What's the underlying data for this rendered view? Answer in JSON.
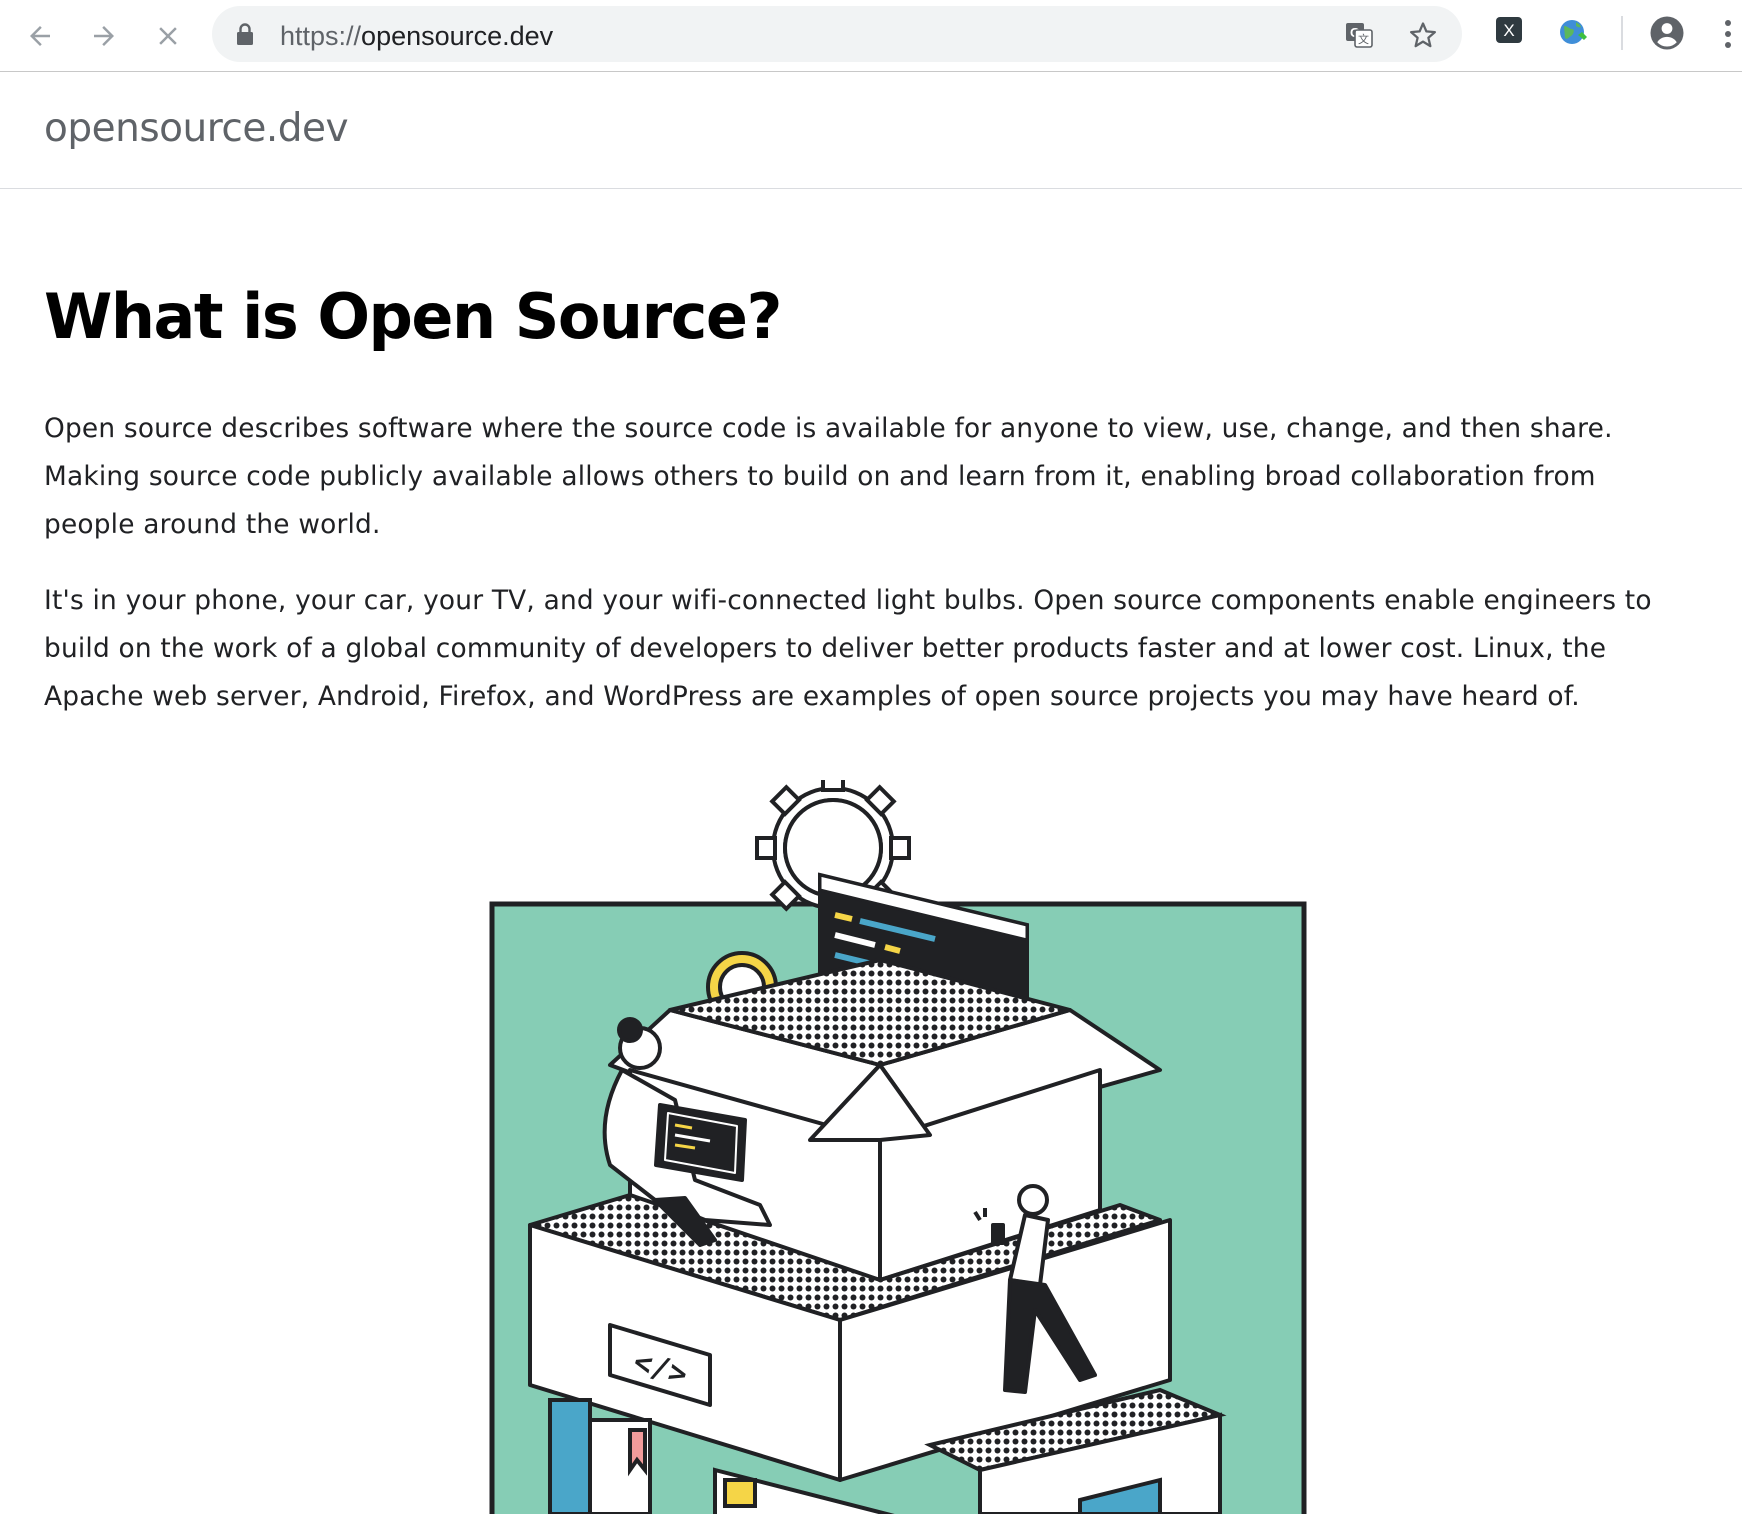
{
  "browser": {
    "url_scheme": "https://",
    "url_host": "opensource.dev",
    "icons": {
      "back": "arrow-left-icon",
      "forward": "arrow-right-icon",
      "stop": "close-icon",
      "lock": "lock-icon",
      "translate": "translate-icon",
      "bookmark": "star-icon",
      "extension1": "x-extension-icon",
      "extension2": "globe-extension-icon",
      "profile": "account-circle-icon",
      "menu": "kebab-menu-icon"
    },
    "extension1_letter": "X"
  },
  "site": {
    "name": "opensource.dev"
  },
  "main": {
    "title": "What is Open Source?",
    "paragraphs": [
      "Open source describes software where the source code is available for anyone to view, use, change, and then share. Making source code publicly available allows others to build on and learn from it, enabling broad collaboration from people around the world.",
      "It's in your phone, your car, your TV, and your wifi-connected light bulbs. Open source components enable engineers to build on the work of a global community of developers to deliver better products faster and at lower cost. Linux, the Apache web server, Android, Firefox, and WordPress are examples of open source projects you may have heard of."
    ],
    "illustration_code_symbol": "</>"
  },
  "colors": {
    "illustration_teal": "#86cdb5",
    "illustration_dark": "#202124",
    "accent_yellow": "#f5d547",
    "accent_blue": "#4aa6c9",
    "accent_pink": "#f29b9b"
  }
}
